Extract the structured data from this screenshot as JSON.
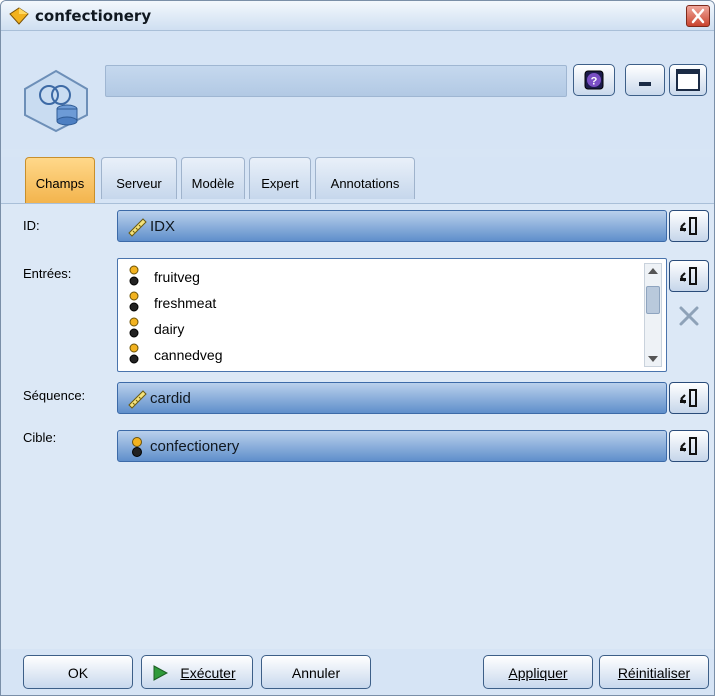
{
  "window": {
    "title": "confectionery"
  },
  "header": {
    "node_name_value": "",
    "help_icon": "question-icon",
    "min_icon": "minimize-icon",
    "max_icon": "maximize-icon"
  },
  "tabs": [
    {
      "label": "Champs",
      "active": true
    },
    {
      "label": "Serveur",
      "active": false
    },
    {
      "label": "Modèle",
      "active": false
    },
    {
      "label": "Expert",
      "active": false
    },
    {
      "label": "Annotations",
      "active": false
    }
  ],
  "fields": {
    "id": {
      "label": "ID:",
      "value": "IDX",
      "icon": "ruler-icon"
    },
    "inputs": {
      "label": "Entrées:",
      "items": [
        {
          "name": "fruitveg",
          "icon": "flag-icon"
        },
        {
          "name": "freshmeat",
          "icon": "flag-icon"
        },
        {
          "name": "dairy",
          "icon": "flag-icon"
        },
        {
          "name": "cannedveg",
          "icon": "flag-icon"
        }
      ]
    },
    "sequence": {
      "label": "Séquence:",
      "value": "cardid",
      "icon": "ruler-icon"
    },
    "target": {
      "label": "Cible:",
      "value": "confectionery",
      "icon": "flag-icon"
    }
  },
  "footer": {
    "ok": "OK",
    "run": "Exécuter",
    "cancel": "Annuler",
    "apply": "Appliquer",
    "reset": "Réinitialiser"
  },
  "colors": {
    "accent_tab": "#f3b44d",
    "field_blue": "#5f8fcb",
    "window_bg": "#d6e4f5"
  }
}
